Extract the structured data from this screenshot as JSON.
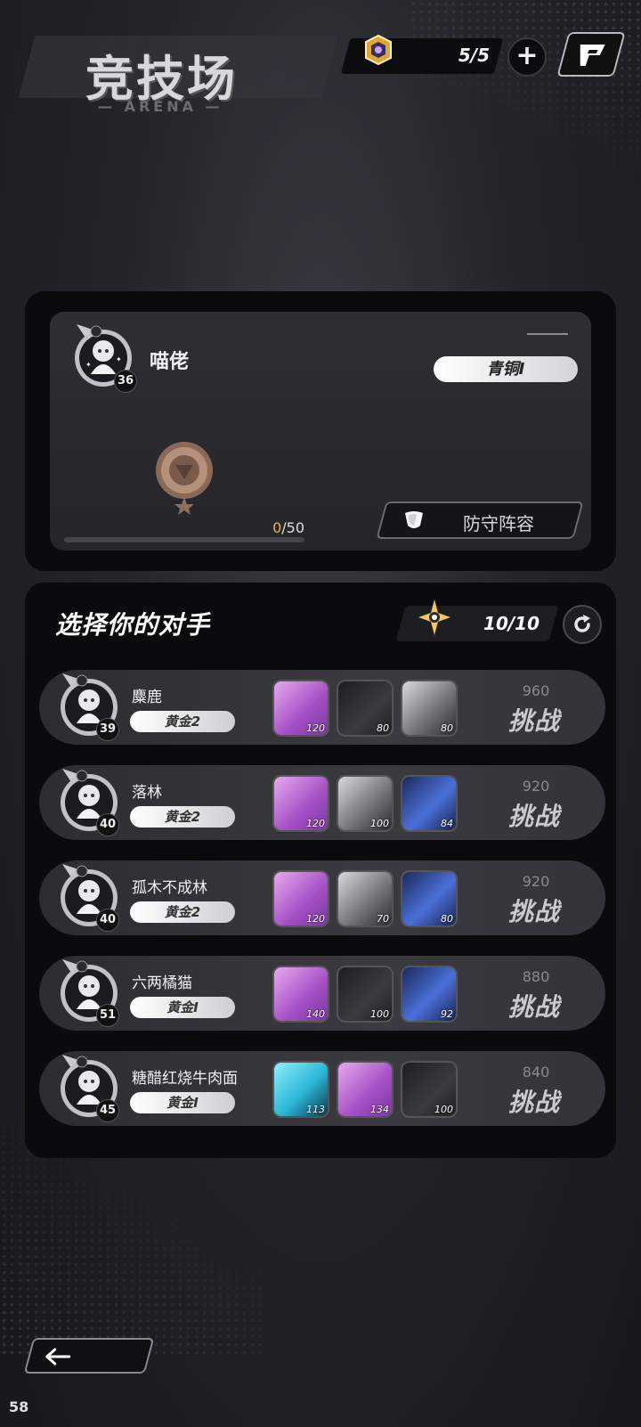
{
  "header": {
    "title": "竞技场",
    "subtitle": "— ARENA —",
    "ticket_count": "5/5",
    "plus_label": "+"
  },
  "player": {
    "name": "喵佬",
    "level": "36",
    "rank": "青铜I",
    "progress_current": "0",
    "progress_max": "/50",
    "progress_fraction": 0,
    "defense_label": "防守阵容"
  },
  "opponents_section": {
    "title": "选择你的对手",
    "attempts": "10/10",
    "challenge_label": "挑战"
  },
  "opponents": [
    {
      "name": "麋鹿",
      "level": "39",
      "tier": "黄金2",
      "power": "960",
      "heroes": [
        {
          "level": "120",
          "type": "pink"
        },
        {
          "level": "80",
          "type": "dark"
        },
        {
          "level": "80",
          "type": "grey"
        }
      ]
    },
    {
      "name": "落林",
      "level": "40",
      "tier": "黄金2",
      "power": "920",
      "heroes": [
        {
          "level": "120",
          "type": "pink"
        },
        {
          "level": "100",
          "type": "grey"
        },
        {
          "level": "84",
          "type": "blue"
        }
      ]
    },
    {
      "name": "孤木不成林",
      "level": "40",
      "tier": "黄金2",
      "power": "920",
      "heroes": [
        {
          "level": "120",
          "type": "pink"
        },
        {
          "level": "70",
          "type": "grey"
        },
        {
          "level": "80",
          "type": "blue"
        }
      ]
    },
    {
      "name": "六两橘猫",
      "level": "51",
      "tier": "黄金I",
      "power": "880",
      "heroes": [
        {
          "level": "140",
          "type": "pink"
        },
        {
          "level": "100",
          "type": "dark"
        },
        {
          "level": "92",
          "type": "blue"
        }
      ]
    },
    {
      "name": "糖醋红烧牛肉面",
      "level": "45",
      "tier": "黄金I",
      "power": "840",
      "heroes": [
        {
          "level": "113",
          "type": "cyan"
        },
        {
          "level": "134",
          "type": "pink"
        },
        {
          "level": "100",
          "type": "dark"
        }
      ]
    }
  ],
  "footer": {
    "corner_number": "58"
  },
  "colors": {
    "accent_gold": "#e5b64a",
    "panel": "#0b0b0d",
    "hero_pink": "#c77ad6",
    "hero_dark": "#2a2a2e",
    "hero_grey": "#8e8e94",
    "hero_blue": "#3a58b8",
    "hero_cyan": "#4fd6ef"
  }
}
